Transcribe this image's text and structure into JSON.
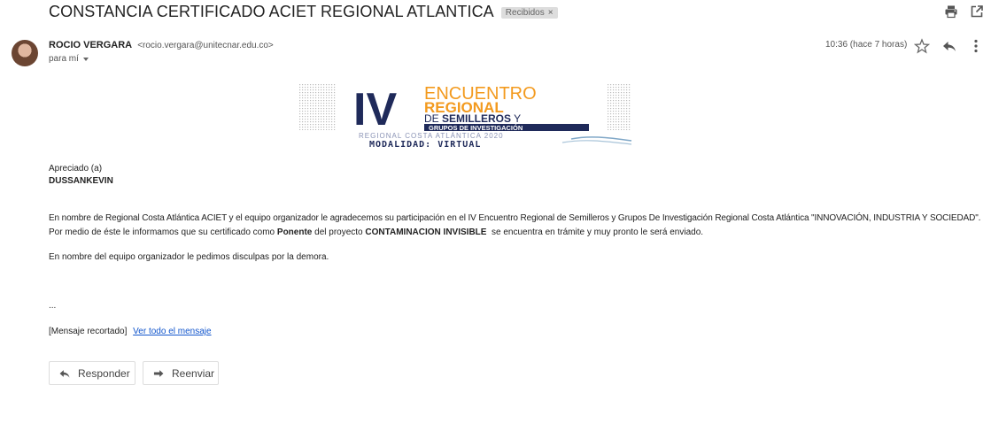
{
  "email": {
    "subject": "CONSTANCIA CERTIFICADO ACIET REGIONAL ATLANTICA",
    "label": "Recibidos",
    "label_close": "×",
    "sender_name": "ROCIO VERGARA",
    "sender_email": "<rocio.vergara@unitecnar.edu.co>",
    "to": "para mí",
    "time": "10:36 (hace 7 horas)"
  },
  "banner": {
    "numeral": "IV",
    "line1": "ENCUENTRO",
    "line2": "REGIONAL",
    "line3_prefix": "DE",
    "line3_main": "SEMILLEROS",
    "line3_suffix": "Y",
    "line4": "GRUPOS DE INVESTIGACIÓN",
    "line5": "REGIONAL COSTA ATLÁNTICA 2020",
    "line6": "MODALIDAD: VIRTUAL"
  },
  "body": {
    "greeting": "Apreciado (a)",
    "recipient": "DUSSANKEVIN",
    "para1": "En nombre de Regional Costa Atlántica ACIET y el equipo organizador le agradecemos su participación en el IV Encuentro Regional de Semilleros y Grupos De Investigación Regional Costa Atlántica \"INNOVACIÓN, INDUSTRIA Y SOCIEDAD\".",
    "para2_a": "Por medio de éste le informamos que su certificado como ",
    "para2_role": "Ponente",
    "para2_b": " del proyecto ",
    "para2_project": "CONTAMINACION INVISIBLE",
    "para2_c": "  se encuentra en trámite y muy pronto le será enviado.",
    "para3": "En nombre del equipo organizador le pedimos disculpas por la demora.",
    "ellipsis": "...",
    "clipped": "[Mensaje recortado]",
    "view_all": "Ver todo el mensaje"
  },
  "actions": {
    "reply": "Responder",
    "forward": "Reenviar"
  },
  "icons": [
    "print-icon",
    "open-new-window-icon",
    "star-icon",
    "reply-icon",
    "more-vert-icon",
    "caret-down-icon",
    "forward-icon"
  ],
  "colors": {
    "banner_navy": "#1f2a5a",
    "banner_orange": "#f39a1e",
    "link": "#1155cc"
  }
}
